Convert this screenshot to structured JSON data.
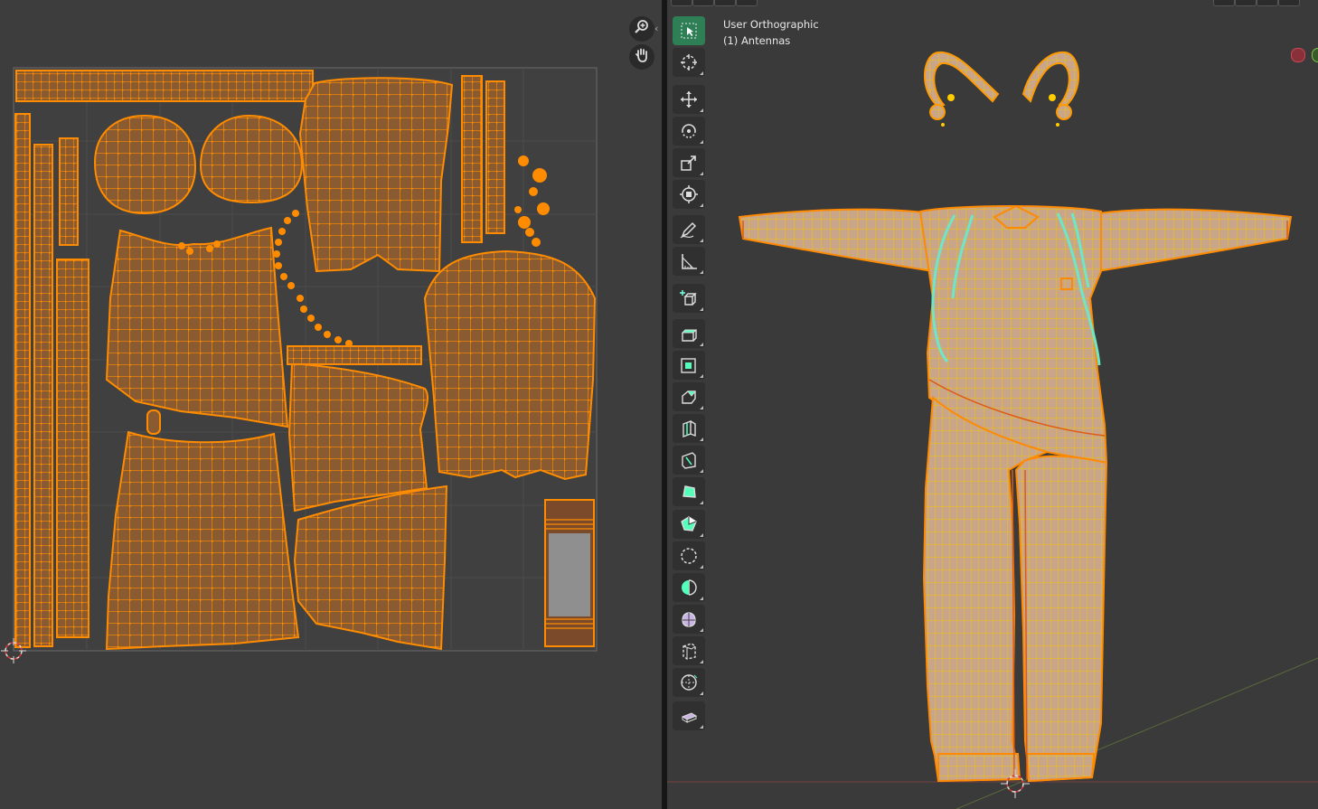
{
  "uv_editor": {
    "tools": [
      "zoom-icon",
      "hand-pan-icon"
    ]
  },
  "viewport": {
    "view_name": "User Orthographic",
    "object_label": "(1) Antennas",
    "toolbar": [
      {
        "name": "tool-select-box",
        "icon": "cursor-box-icon",
        "active": true
      },
      {
        "name": "tool-cursor",
        "icon": "crosshair-cursor-icon",
        "active": false
      },
      {
        "name": "tool-move",
        "icon": "move-arrows-icon",
        "active": false
      },
      {
        "name": "tool-rotate",
        "icon": "rotate-icon",
        "active": false
      },
      {
        "name": "tool-scale",
        "icon": "scale-icon",
        "active": false
      },
      {
        "name": "tool-transform",
        "icon": "transform-icon",
        "active": false
      },
      {
        "name": "tool-annotate",
        "icon": "pencil-annotate-icon",
        "active": false
      },
      {
        "name": "tool-measure",
        "icon": "ruler-measure-icon",
        "active": false
      },
      {
        "name": "tool-add-cube",
        "icon": "add-cube-icon",
        "active": false
      },
      {
        "name": "tool-extrude",
        "icon": "extrude-region-icon",
        "active": false
      },
      {
        "name": "tool-inset",
        "icon": "inset-faces-icon",
        "active": false
      },
      {
        "name": "tool-bevel",
        "icon": "bevel-icon",
        "active": false
      },
      {
        "name": "tool-loop-cut",
        "icon": "loop-cut-icon",
        "active": false
      },
      {
        "name": "tool-knife",
        "icon": "knife-icon",
        "active": false
      },
      {
        "name": "tool-poly-build",
        "icon": "poly-build-icon",
        "active": false
      },
      {
        "name": "tool-spin",
        "icon": "spin-icon",
        "active": false
      },
      {
        "name": "tool-smooth",
        "icon": "smooth-vertices-icon",
        "active": false
      },
      {
        "name": "tool-edge-slide",
        "icon": "edge-slide-icon",
        "active": false
      },
      {
        "name": "tool-shrink-fatten",
        "icon": "shrink-fatten-icon",
        "active": false
      },
      {
        "name": "tool-shear",
        "icon": "shear-icon",
        "active": false
      },
      {
        "name": "tool-to-sphere",
        "icon": "sphere-icon",
        "active": false
      },
      {
        "name": "tool-rip-region",
        "icon": "rip-region-icon",
        "active": false
      }
    ]
  },
  "colors": {
    "uv_island_fill": "#8a5a30",
    "uv_wire": "#ff8c00",
    "uv_background": "#3d3d3d",
    "viewport_background": "#3a3a3a",
    "mesh_fill": "#c9a58a",
    "mesh_wire": "#f2c200",
    "mesh_outline": "#ff8a00",
    "strap_highlight": "#6ee6c8",
    "active_tool": "#2e7f55"
  }
}
